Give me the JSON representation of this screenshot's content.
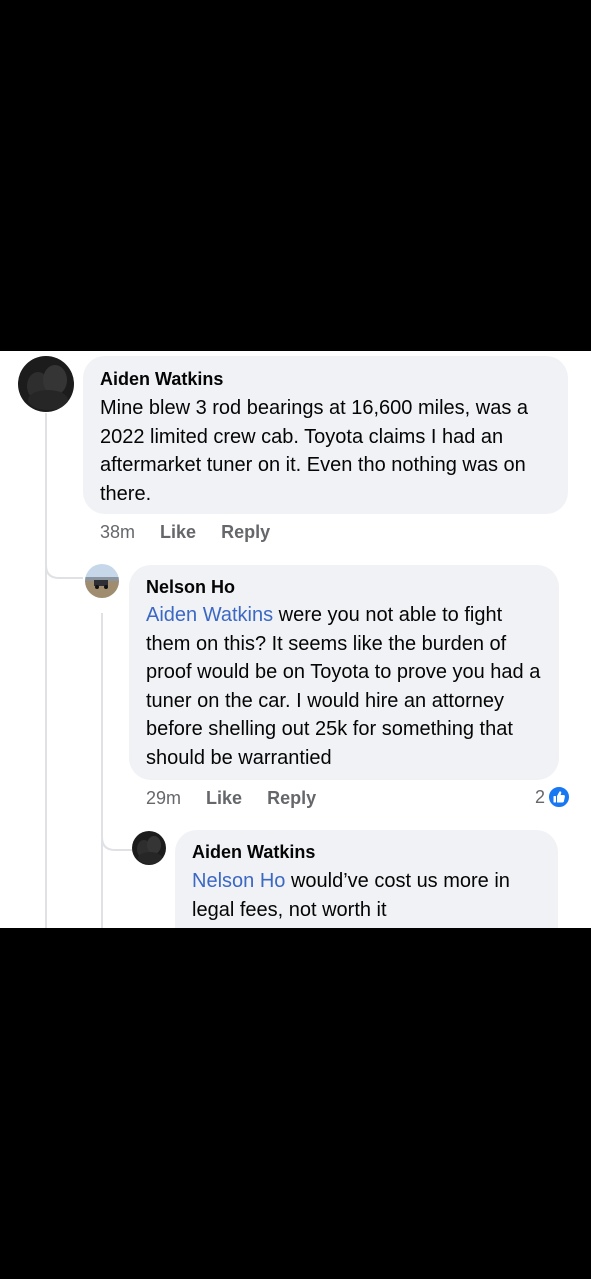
{
  "comments": [
    {
      "author": "Aiden Watkins",
      "text": "Mine blew 3 rod bearings at 16,600 miles, was a 2022 limited crew cab. Toyota claims I had an aftermarket tuner on it. Even tho nothing was on there.",
      "time": "38m",
      "like_label": "Like",
      "reply_label": "Reply"
    },
    {
      "author": "Nelson Ho",
      "mention": "Aiden Watkins",
      "text": " were you not able to fight them on this? It seems like the burden of proof would be on Toyota to prove you had a tuner on the car. I would hire an attorney before shelling out 25k for something that should be warrantied",
      "time": "29m",
      "like_label": "Like",
      "reply_label": "Reply",
      "reaction_count": "2",
      "reaction_icon": "thumbs-up-icon",
      "reaction_color": "#1877f2"
    },
    {
      "author": "Aiden Watkins",
      "mention": "Nelson Ho",
      "text": " would’ve cost us more in legal fees, not worth it"
    }
  ],
  "colors": {
    "bubble": "#f0f2f5",
    "mention": "#3b68c4",
    "meta": "#65676b",
    "thread_line": "#dfe1e5"
  }
}
